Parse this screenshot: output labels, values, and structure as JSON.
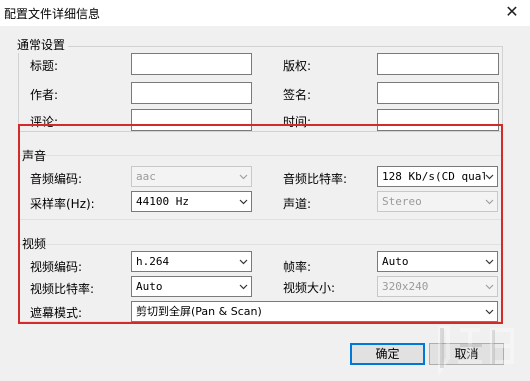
{
  "window": {
    "title": "配置文件详细信息",
    "close_glyph": "✕"
  },
  "general": {
    "section_label": "通常设置",
    "title_label": "标题:",
    "copyright_label": "版权:",
    "author_label": "作者:",
    "signature_label": "签名:",
    "comment_label": "评论:",
    "time_label": "时间:"
  },
  "audio": {
    "section_label": "声音",
    "codec_label": "音频编码:",
    "codec_value": "aac",
    "bitrate_label": "音频比特率:",
    "bitrate_value": "128 Kb/s(CD qual",
    "samplerate_label": "采样率(Hz):",
    "samplerate_value": "44100 Hz",
    "channel_label": "声道:",
    "channel_value": "Stereo"
  },
  "video": {
    "section_label": "视频",
    "codec_label": "视频编码:",
    "codec_value": "h.264",
    "framerate_label": "帧率:",
    "framerate_value": "Auto",
    "bitrate_label": "视频比特率:",
    "bitrate_value": "Auto",
    "size_label": "视频大小:",
    "size_value": "320x240",
    "mask_label": "遮幕模式:",
    "mask_value": "剪切到全屏(Pan & Scan)"
  },
  "buttons": {
    "ok": "确定",
    "cancel": "取消"
  },
  "colors": {
    "highlight_border": "#d42a2a",
    "default_button_border": "#0078d7"
  },
  "watermark": "logo"
}
